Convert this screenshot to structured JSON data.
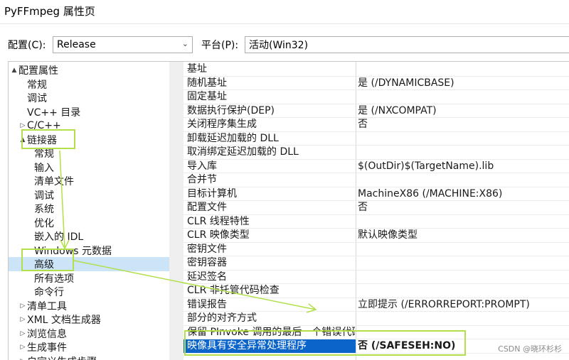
{
  "window": {
    "title": "PyFFmpeg 属性页"
  },
  "config_bar": {
    "configuration_label": "配置(C):",
    "configuration_value": "Release",
    "platform_label": "平台(P):",
    "platform_value": "活动(Win32)"
  },
  "tree": {
    "items": [
      {
        "label": "配置属性",
        "expander": "▲"
      },
      {
        "label": "常规",
        "expander": ""
      },
      {
        "label": "调试",
        "expander": ""
      },
      {
        "label": "VC++ 目录",
        "expander": ""
      },
      {
        "label": "C/C++",
        "expander": "▷"
      },
      {
        "label": "链接器",
        "expander": "▲"
      },
      {
        "label": "常规",
        "expander": ""
      },
      {
        "label": "输入",
        "expander": ""
      },
      {
        "label": "清单文件",
        "expander": ""
      },
      {
        "label": "调试",
        "expander": ""
      },
      {
        "label": "系统",
        "expander": ""
      },
      {
        "label": "优化",
        "expander": ""
      },
      {
        "label": "嵌入的 IDL",
        "expander": ""
      },
      {
        "label": "Windows 元数据",
        "expander": ""
      },
      {
        "label": "高级",
        "expander": ""
      },
      {
        "label": "所有选项",
        "expander": ""
      },
      {
        "label": "命令行",
        "expander": ""
      },
      {
        "label": "清单工具",
        "expander": "▷"
      },
      {
        "label": "XML 文档生成器",
        "expander": "▷"
      },
      {
        "label": "浏览信息",
        "expander": "▷"
      },
      {
        "label": "生成事件",
        "expander": "▷"
      },
      {
        "label": "自定义生成步骤",
        "expander": "▷"
      }
    ]
  },
  "properties": {
    "rows": [
      {
        "name": "基址",
        "value": ""
      },
      {
        "name": "随机基址",
        "value": "是 (/DYNAMICBASE)"
      },
      {
        "name": "固定基址",
        "value": ""
      },
      {
        "name": "数据执行保护(DEP)",
        "value": "是 (/NXCOMPAT)"
      },
      {
        "name": "关闭程序集生成",
        "value": "否"
      },
      {
        "name": "卸载延迟加载的 DLL",
        "value": ""
      },
      {
        "name": "取消绑定延迟加载的 DLL",
        "value": ""
      },
      {
        "name": "导入库",
        "value": "$(OutDir)$(TargetName).lib"
      },
      {
        "name": "合并节",
        "value": ""
      },
      {
        "name": "目标计算机",
        "value": "MachineX86 (/MACHINE:X86)"
      },
      {
        "name": "配置文件",
        "value": "否"
      },
      {
        "name": "CLR 线程特性",
        "value": ""
      },
      {
        "name": "CLR 映像类型",
        "value": "默认映像类型"
      },
      {
        "name": "密钥文件",
        "value": ""
      },
      {
        "name": "密钥容器",
        "value": ""
      },
      {
        "name": "延迟签名",
        "value": ""
      },
      {
        "name": "CLR 非托管代码检查",
        "value": ""
      },
      {
        "name": "错误报告",
        "value": "立即提示 (/ERRORREPORT:PROMPT)"
      },
      {
        "name": "部分的对齐方式",
        "value": ""
      },
      {
        "name": "保留 PInvoke 调用的最后一个错误代码",
        "value": ""
      },
      {
        "name": "映像具有安全异常处理程序",
        "value": "否 (/SAFESEH:NO)"
      }
    ]
  },
  "watermark": "CSDN @晓环杉杉",
  "annotation_color": "#b3e04a",
  "selection_color": "#0a64c9"
}
